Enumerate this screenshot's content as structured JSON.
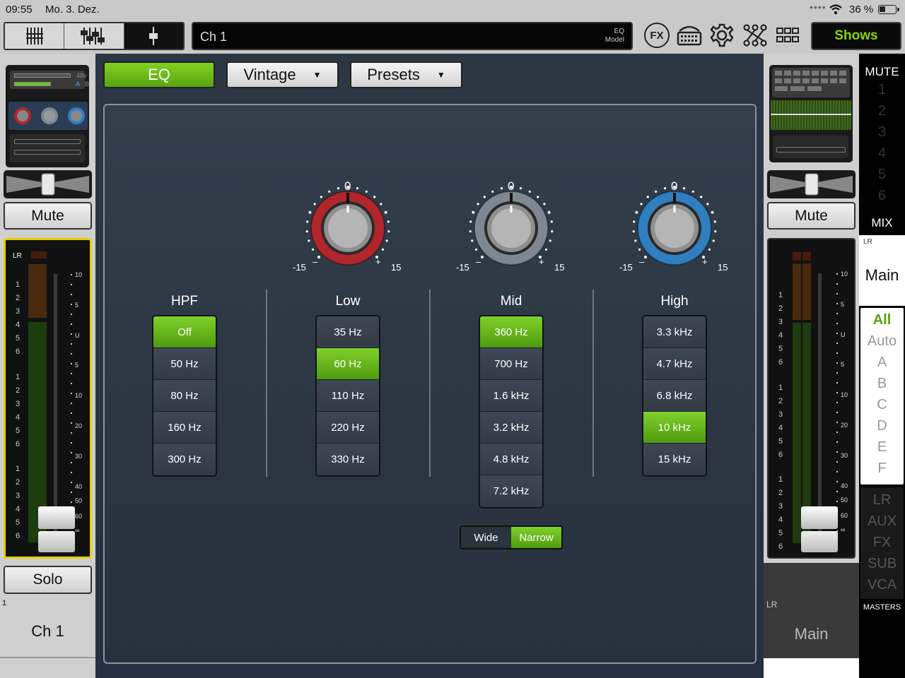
{
  "status": {
    "time": "09:55",
    "date": "Mo. 3. Dez.",
    "battery": "36 %"
  },
  "topbar": {
    "channel_name": "Ch 1",
    "eq_model_line1": "EQ",
    "eq_model_line2": "Model",
    "fx_label": "FX",
    "shows_label": "Shows"
  },
  "left": {
    "phantom": "48v",
    "ab_a": "A",
    "ab_b": "B",
    "mute": "Mute",
    "meter_label": "LR",
    "solo": "Solo",
    "channel_number": "1",
    "channel_name": "Ch 1"
  },
  "tabs": {
    "eq": "EQ",
    "model": "Vintage",
    "presets": "Presets"
  },
  "knob_labels": {
    "zero": "0",
    "min": "-15",
    "max": "15",
    "minus": "–",
    "plus": "+"
  },
  "bands": [
    {
      "title": "HPF",
      "options": [
        "Off",
        "50 Hz",
        "80 Hz",
        "160 Hz",
        "300 Hz"
      ],
      "selected": 0
    },
    {
      "title": "Low",
      "options": [
        "35 Hz",
        "60 Hz",
        "110 Hz",
        "220 Hz",
        "330 Hz"
      ],
      "selected": 1
    },
    {
      "title": "Mid",
      "options": [
        "360 Hz",
        "700 Hz",
        "1.6 kHz",
        "3.2 kHz",
        "4.8 kHz",
        "7.2 kHz"
      ],
      "selected": 0
    },
    {
      "title": "High",
      "options": [
        "3.3 kHz",
        "4.7 kHz",
        "6.8 kHz",
        "10 kHz",
        "15 kHz"
      ],
      "selected": 3
    }
  ],
  "bandwidth": {
    "wide": "Wide",
    "narrow": "Narrow",
    "selected": "Narrow"
  },
  "meter_scale": [
    "10",
    "5",
    "U",
    "5",
    "10",
    "20",
    "30",
    "40",
    "50",
    "60",
    "∞"
  ],
  "right": {
    "mute": "Mute",
    "mix_label": "LR",
    "mix_name": "Main",
    "bottom_label": "LR",
    "bottom_name": "Main"
  },
  "rightcol": {
    "mute_header": "MUTE",
    "mute_groups": [
      "1",
      "2",
      "3",
      "4",
      "5",
      "6"
    ],
    "mix_header": "MIX",
    "filters": [
      "All",
      "Auto",
      "A",
      "B",
      "C",
      "D",
      "E",
      "F"
    ],
    "masters": [
      "LR",
      "AUX",
      "FX",
      "SUB",
      "VCA"
    ],
    "masters_header": "MASTERS"
  },
  "colors": {
    "accent_green": "#7ed321",
    "low_knob": "#b0262b",
    "mid_knob": "#7d8893",
    "high_knob": "#2f7fc0"
  }
}
